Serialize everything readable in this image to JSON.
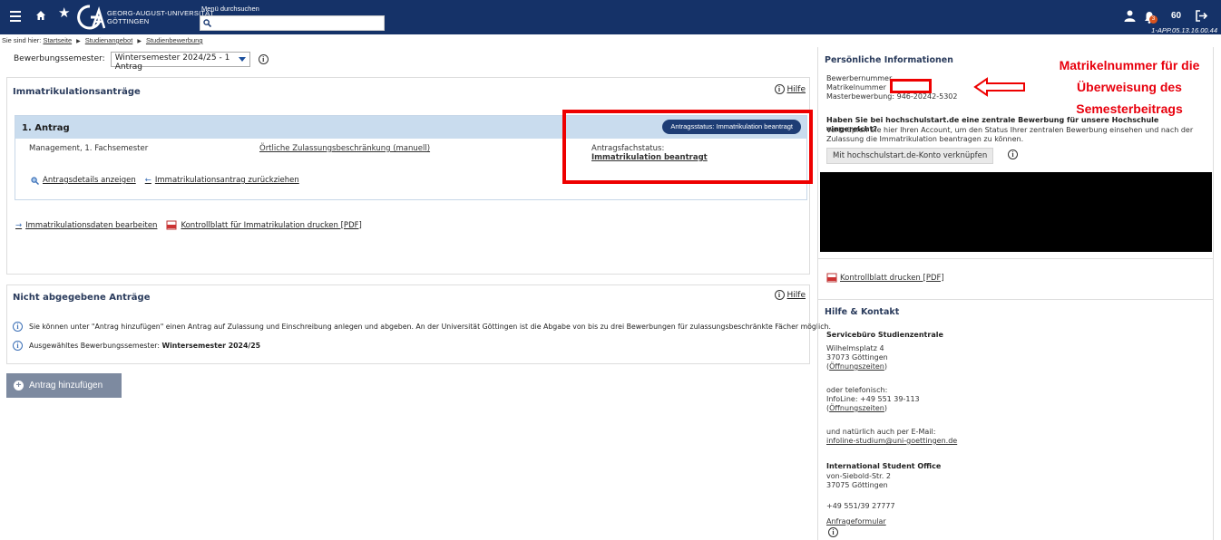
{
  "topbar": {
    "logo_line1": "GEORG-AUGUST-UNIVERSITÄT",
    "logo_line2": "GÖTTINGEN",
    "search_label": "Menü durchsuchen",
    "search_value": "",
    "notifications_count": "3",
    "session_timer": "60",
    "version": "1-APP.05.13.16.00.44"
  },
  "breadcrumb": {
    "prefix": "Sie sind hier:",
    "items": [
      "Startseite",
      "Studienangebot",
      "Studienbewerbung"
    ]
  },
  "semester": {
    "label": "Bewerbungssemester:",
    "selected": "Wintersemester 2024/25 - 1 Antrag"
  },
  "applications": {
    "title": "Immatrikulationsanträge",
    "help": "Hilfe",
    "antrag": {
      "title": "1. Antrag",
      "status_pill": "Antragsstatus: Immatrikulation beantragt",
      "program": "Management, 1. Fachsemester",
      "restriction": "Örtliche Zulassungsbeschränkung (manuell)",
      "fachstatus_label": "Antragsfachstatus:",
      "fachstatus_value": "Immatrikulation beantragt",
      "details_link": "Antragsdetails anzeigen",
      "withdraw_link": "Immatrikulationsantrag zurückziehen"
    },
    "edit_link": "Immatrikulationsdaten bearbeiten",
    "print_link": "Kontrollblatt für Immatrikulation drucken [PDF]"
  },
  "not_submitted": {
    "title": "Nicht abgegebene Anträge",
    "help": "Hilfe",
    "info1": "Sie können unter \"Antrag hinzufügen\" einen Antrag auf Zulassung und Einschreibung anlegen und abgeben. An der Universität Göttingen ist die Abgabe von bis zu drei Bewerbungen für zulassungsbeschränkte Fächer möglich.",
    "info2_prefix": "Ausgewähltes Bewerbungssemester:",
    "info2_value": "Wintersemester 2024/25"
  },
  "add_button": "Antrag hinzufügen",
  "personal": {
    "title": "Persönliche Informationen",
    "bewerbernummer": "Bewerbernummer",
    "matrikelnummer": "Matrikelnummer",
    "masterbewerbung": "Masterbewerbung: 946-20242-5302",
    "hochschulstart_q": "Haben Sie bei hochschulstart.de eine zentrale Bewerbung für unsere Hochschule eingereicht?",
    "hochschulstart_text": "Verknüpfen Sie hier Ihren Account, um den Status Ihrer zentralen Bewerbung einsehen und nach der Zulassung die Immatrikulation beantragen zu können.",
    "link_button": "Mit hochschulstart.de-Konto verknüpfen",
    "print_link": "Kontrollblatt drucken [PDF]"
  },
  "contact": {
    "title": "Hilfe & Kontakt",
    "office": "Servicebüro Studienzentrale",
    "street": "Wilhelmsplatz 4",
    "city": "37073 Göttingen",
    "hours": "Öffnungszeiten",
    "phone_intro": "oder telefonisch:",
    "infoline": "InfoLine: +49 551 39-113",
    "hours2": "Öffnungszeiten",
    "email_intro": "und natürlich auch per E-Mail:",
    "email": "infoline-studium@uni-goettingen.de",
    "intl_office": "International Student Office",
    "intl_street": "von-Siebold-Str. 2",
    "intl_city": "37075 Göttingen",
    "intl_phone": "+49 551/39 27777",
    "form": "Anfrageformular"
  },
  "annotation": {
    "line1": "Matrikelnummer für die",
    "line2": "Überweisung des",
    "line3": "Semesterbeitrags",
    "color": "#e00000"
  },
  "colors": {
    "topbar": "#153268",
    "accent": "#1e3d75",
    "antrag_header": "#c9dcee",
    "add_button": "#7d8aa0"
  }
}
